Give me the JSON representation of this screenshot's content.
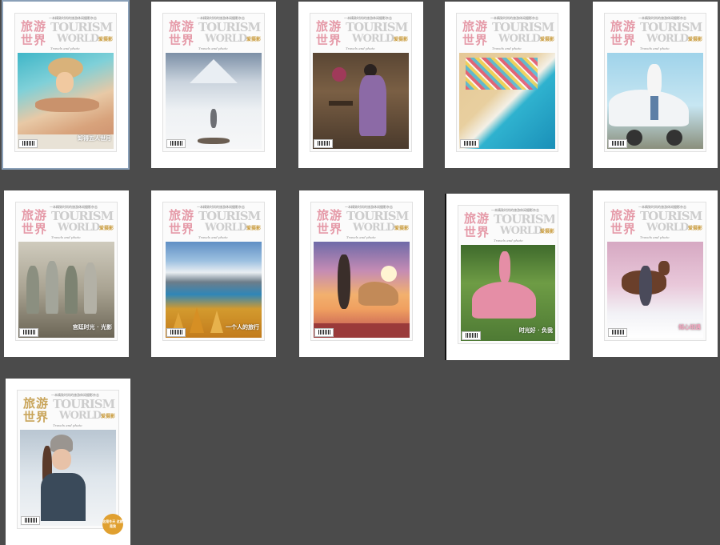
{
  "magazine": {
    "tagline": "一本精致时尚的旅游休闲摄影杂志",
    "cn_title": "旅游世界",
    "en_title_line1": "TOURISM",
    "en_title_line2": "WORLD",
    "brand": "爱摄影",
    "script": "Travels and photo"
  },
  "thumbnails": [
    {
      "selected": true,
      "overlay": "卸得五人世月",
      "overlay_color": "#ffffff"
    },
    {
      "selected": false,
      "overlay": "",
      "overlay_color": "#ffffff"
    },
    {
      "selected": false,
      "overlay": "",
      "overlay_color": "#ffffff"
    },
    {
      "selected": false,
      "overlay": "",
      "overlay_color": "#ffffff"
    },
    {
      "selected": false,
      "overlay": "",
      "overlay_color": "#ffffff"
    },
    {
      "selected": false,
      "overlay": "宫廷时光 · 光影",
      "overlay_color": "#ffffff"
    },
    {
      "selected": false,
      "overlay": "一个人的旅行",
      "overlay_color": "#ffffff"
    },
    {
      "selected": false,
      "overlay": "",
      "overlay_color": "#ffffff"
    },
    {
      "selected": false,
      "overlay": "时光好 · 负我",
      "overlay_color": "#ffffff"
    },
    {
      "selected": false,
      "overlay": "倾心相遇",
      "overlay_color": "#f5a8c0"
    },
    {
      "selected": false,
      "overlay": "",
      "overlay_color": "#ffffff",
      "badge": "这是冬天 这就是我"
    }
  ]
}
